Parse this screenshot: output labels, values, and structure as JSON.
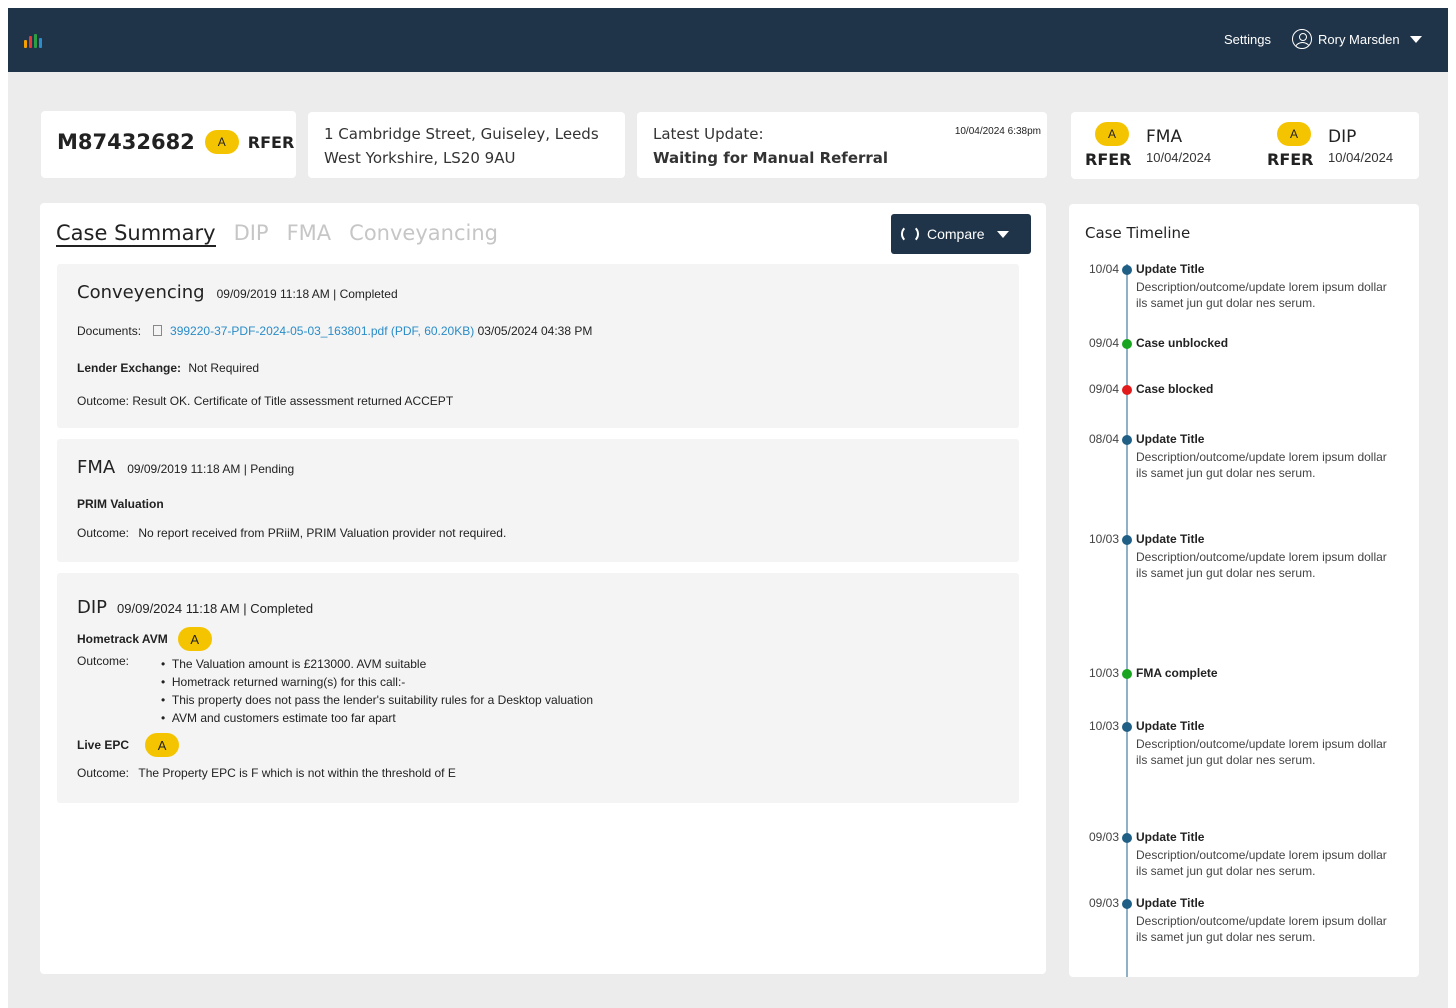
{
  "header": {
    "settings_label": "Settings",
    "user_name": "Rory Marsden",
    "logo_colors": [
      "#f5a000",
      "#e53935",
      "#2e9e44",
      "#2a8cc8"
    ]
  },
  "case": {
    "id": "M87432682",
    "badge": "A",
    "status": "RFER"
  },
  "address": {
    "line1": "1 Cambridge Street, Guiseley, Leeds",
    "line2": "West Yorkshire, LS20 9AU"
  },
  "latest_update": {
    "label": "Latest Update:",
    "value": "Waiting for Manual Referral",
    "timestamp": "10/04/2024 6:38pm"
  },
  "status_cards": [
    {
      "badge": "A",
      "status": "RFER",
      "name": "FMA",
      "date": "10/04/2024"
    },
    {
      "badge": "A",
      "status": "RFER",
      "name": "DIP",
      "date": "10/04/2024"
    }
  ],
  "tabs": [
    {
      "label": "Case Summary",
      "active": true
    },
    {
      "label": "DIP",
      "active": false
    },
    {
      "label": "FMA",
      "active": false
    },
    {
      "label": "Conveyancing",
      "active": false
    }
  ],
  "compare_label": "Compare",
  "conveyencing": {
    "title": "Conveyencing",
    "meta": "09/09/2019 11:18 AM | Completed",
    "documents_label": "Documents:",
    "document_link": "399220-37-PDF-2024-05-03_163801.pdf (PDF, 60.20KB)",
    "document_date": "03/05/2024 04:38 PM",
    "lender_label": "Lender Exchange:",
    "lender_value": "Not Required",
    "outcome": "Outcome: Result OK. Certificate of Title assessment returned ACCEPT"
  },
  "fma": {
    "title": "FMA",
    "meta": "09/09/2019 11:18 AM | Pending",
    "sub": "PRIM Valuation",
    "outcome_label": "Outcome:",
    "outcome_value": "No report received from PRiiM, PRIM Valuation provider not required."
  },
  "dip": {
    "title": "DIP",
    "meta": "09/09/2024 11:18 AM | Completed",
    "hometrack_label": "Hometrack AVM",
    "hometrack_badge": "A",
    "outcome_label": "Outcome:",
    "bullets": [
      "The Valuation amount is £213000. AVM suitable",
      "Hometrack returned warning(s) for this call:-",
      "This property does not pass the lender's suitability rules for a Desktop valuation",
      "AVM and customers estimate too far apart"
    ],
    "epc_label": "Live EPC",
    "epc_badge": "A",
    "epc_outcome_label": "Outcome:",
    "epc_outcome": "The Property EPC is F which is not within the threshold of E"
  },
  "timeline": {
    "title": "Case Timeline",
    "items": [
      {
        "date": "10/04",
        "title": "Update Title",
        "desc": "Description/outcome/update lorem ipsum dollar ils samet jun gut dolar nes serum.",
        "color": "#1f5f85"
      },
      {
        "date": "09/04",
        "title": "Case unblocked",
        "desc": "",
        "color": "#1aa521"
      },
      {
        "date": "09/04",
        "title": "Case blocked",
        "desc": "",
        "color": "#e11b1b"
      },
      {
        "date": "08/04",
        "title": "Update Title",
        "desc": "Description/outcome/update lorem ipsum dollar ils samet jun gut dolar nes serum.",
        "color": "#1f5f85"
      },
      {
        "date": "10/03",
        "title": "Update Title",
        "desc": "Description/outcome/update lorem ipsum dollar ils samet jun gut dolar nes serum.",
        "color": "#1f5f85"
      },
      {
        "date": "10/03",
        "title": "FMA complete",
        "desc": "",
        "color": "#1aa521"
      },
      {
        "date": "10/03",
        "title": "Update Title",
        "desc": "Description/outcome/update lorem ipsum dollar ils samet jun gut dolar nes serum.",
        "color": "#1f5f85"
      },
      {
        "date": "09/03",
        "title": "Update Title",
        "desc": "Description/outcome/update lorem ipsum dollar ils samet jun gut dolar nes serum.",
        "color": "#1f5f85"
      },
      {
        "date": "09/03",
        "title": "Update Title",
        "desc": "Description/outcome/update lorem ipsum dollar ils samet jun gut dolar nes serum.",
        "color": "#1f5f85"
      }
    ]
  }
}
